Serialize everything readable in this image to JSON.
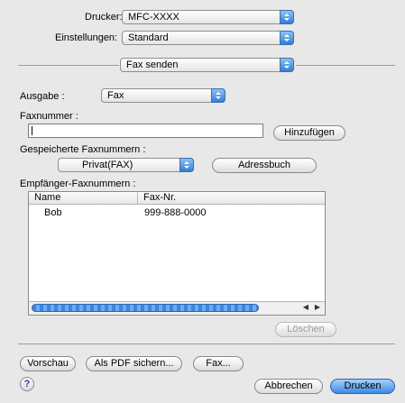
{
  "printer": {
    "label": "Drucker:",
    "value": "MFC-XXXX"
  },
  "presets": {
    "label": "Einstellungen:",
    "value": "Standard"
  },
  "panel": {
    "value": "Fax senden"
  },
  "output": {
    "label": "Ausgabe :",
    "value": "Fax"
  },
  "fax_number": {
    "label": "Faxnummer :",
    "value": "",
    "add_label": "Hinzufügen"
  },
  "stored": {
    "label": "Gespeicherte Faxnummern :",
    "value": "Privat(FAX)",
    "address_book_label": "Adressbuch"
  },
  "recipients": {
    "label": "Empfänger-Faxnummern :",
    "columns": [
      "Name",
      "Fax-Nr."
    ],
    "rows": [
      {
        "name": "Bob",
        "fax": "999-888-0000"
      }
    ],
    "delete_label": "Löschen"
  },
  "footer": {
    "preview_label": "Vorschau",
    "save_pdf_label": "Als PDF sichern...",
    "fax_label": "Fax...",
    "help_label": "?",
    "cancel_label": "Abbrechen",
    "print_label": "Drucken"
  },
  "colors": {
    "accent": "#3c8ae3",
    "window_bg": "#e8e8e8"
  }
}
